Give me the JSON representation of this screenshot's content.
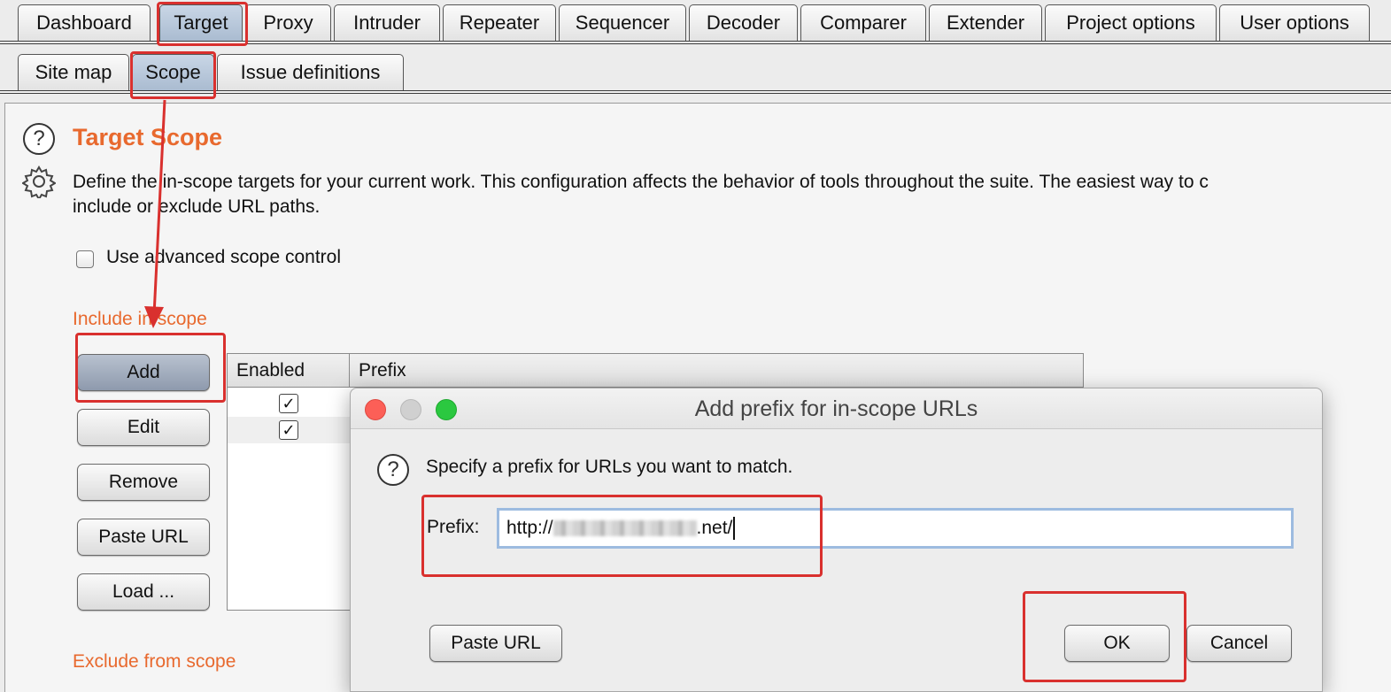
{
  "main_tabs": [
    "Dashboard",
    "Target",
    "Proxy",
    "Intruder",
    "Repeater",
    "Sequencer",
    "Decoder",
    "Comparer",
    "Extender",
    "Project options",
    "User options"
  ],
  "main_tab_selected": "Target",
  "sub_tabs": [
    "Site map",
    "Scope",
    "Issue definitions"
  ],
  "sub_tab_selected": "Scope",
  "scope": {
    "title": "Target Scope",
    "description_line1": "Define the in-scope targets for your current work. This configuration affects the behavior of tools throughout the suite. The easiest way to c",
    "description_line2": "include or exclude URL paths.",
    "advanced_label": "Use advanced scope control",
    "include_label": "Include in scope",
    "exclude_label": "Exclude from scope",
    "buttons": [
      "Add",
      "Edit",
      "Remove",
      "Paste URL",
      "Load ..."
    ],
    "table": {
      "columns": [
        "Enabled",
        "Prefix"
      ],
      "rows": [
        {
          "enabled": "✓"
        },
        {
          "enabled": "✓"
        }
      ]
    }
  },
  "dialog": {
    "title": "Add prefix for in-scope URLs",
    "prompt": "Specify a prefix for URLs you want to match.",
    "prefix_label": "Prefix:",
    "prefix_start": "http://",
    "prefix_end": ".net/",
    "paste_url": "Paste URL",
    "ok": "OK",
    "cancel": "Cancel"
  },
  "icons": {
    "help": "?",
    "settings": "gear-icon"
  },
  "colors": {
    "accent_orange": "#e8692e",
    "highlight_red": "#d9302e",
    "selected_tab": "#b8c7da"
  }
}
